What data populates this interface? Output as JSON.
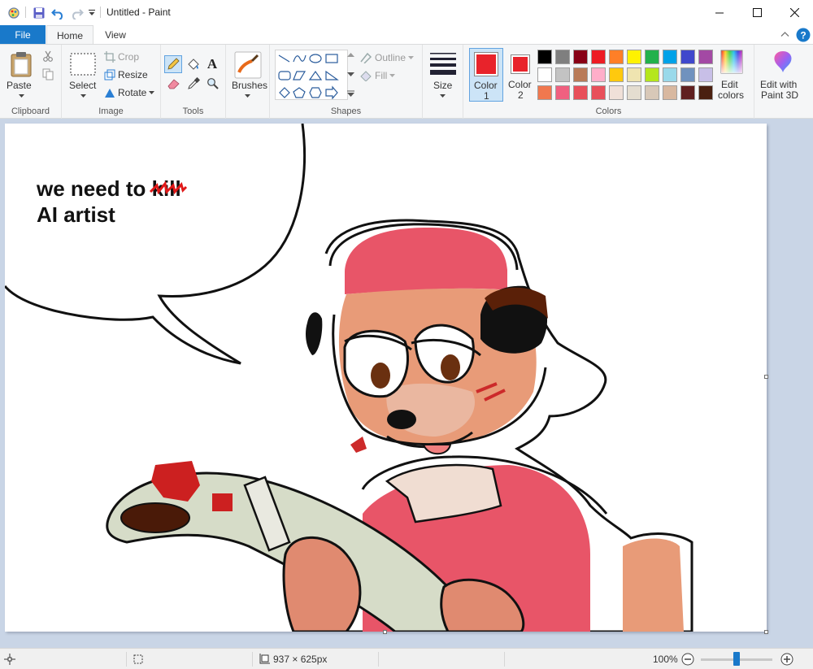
{
  "titlebar": {
    "title": "Untitled - Paint",
    "icons": [
      "paint-app-icon",
      "save-icon",
      "undo-icon",
      "redo-icon",
      "customize-quick-access-icon"
    ]
  },
  "tabs": [
    {
      "label": "File"
    },
    {
      "label": "Home"
    },
    {
      "label": "View"
    }
  ],
  "ribbon": {
    "clipboard": {
      "group": "Clipboard",
      "paste": "Paste"
    },
    "image": {
      "group": "Image",
      "select": "Select",
      "crop": "Crop",
      "resize": "Resize",
      "rotate": "Rotate"
    },
    "tools": {
      "group": "Tools"
    },
    "brushes": {
      "label": "Brushes"
    },
    "shapes": {
      "group": "Shapes",
      "outline": "Outline",
      "fill": "Fill"
    },
    "size": {
      "label": "Size"
    },
    "colors": {
      "group": "Colors",
      "color1": "Color\n1",
      "color1_a": "Color",
      "color1_b": "1",
      "color2_a": "Color",
      "color2_b": "2",
      "color1_value": "#e8232b",
      "color2_value": "#e8232b",
      "edit_a": "Edit",
      "edit_b": "colors",
      "paint3d_a": "Edit with",
      "paint3d_b": "Paint 3D",
      "palette_row1": [
        "#000000",
        "#7f7f7f",
        "#880015",
        "#ed1c24",
        "#ff7f27",
        "#fff200",
        "#22b14c",
        "#00a2e8",
        "#3f48cc",
        "#a349a4"
      ],
      "palette_row2": [
        "#ffffff",
        "#c3c3c3",
        "#b97a57",
        "#ffaec9",
        "#ffc90e",
        "#efe4b0",
        "#b5e61d",
        "#99d9ea",
        "#7092be",
        "#c8bfe7"
      ],
      "palette_row3": [
        "#f0784f",
        "#f06080",
        "#e8505a",
        "#e8505a",
        "#f0e0d8",
        "#e4ddd0",
        "#d8c8b8",
        "#d8b8a0",
        "#602020",
        "#4a2010"
      ]
    }
  },
  "canvas": {
    "speech_line1": "we need to ",
    "struck_word": "kill",
    "speech_line2": "AI artist"
  },
  "status": {
    "dimensions": "937 × 625px",
    "zoom": "100%",
    "zoom_level": 1.0
  }
}
